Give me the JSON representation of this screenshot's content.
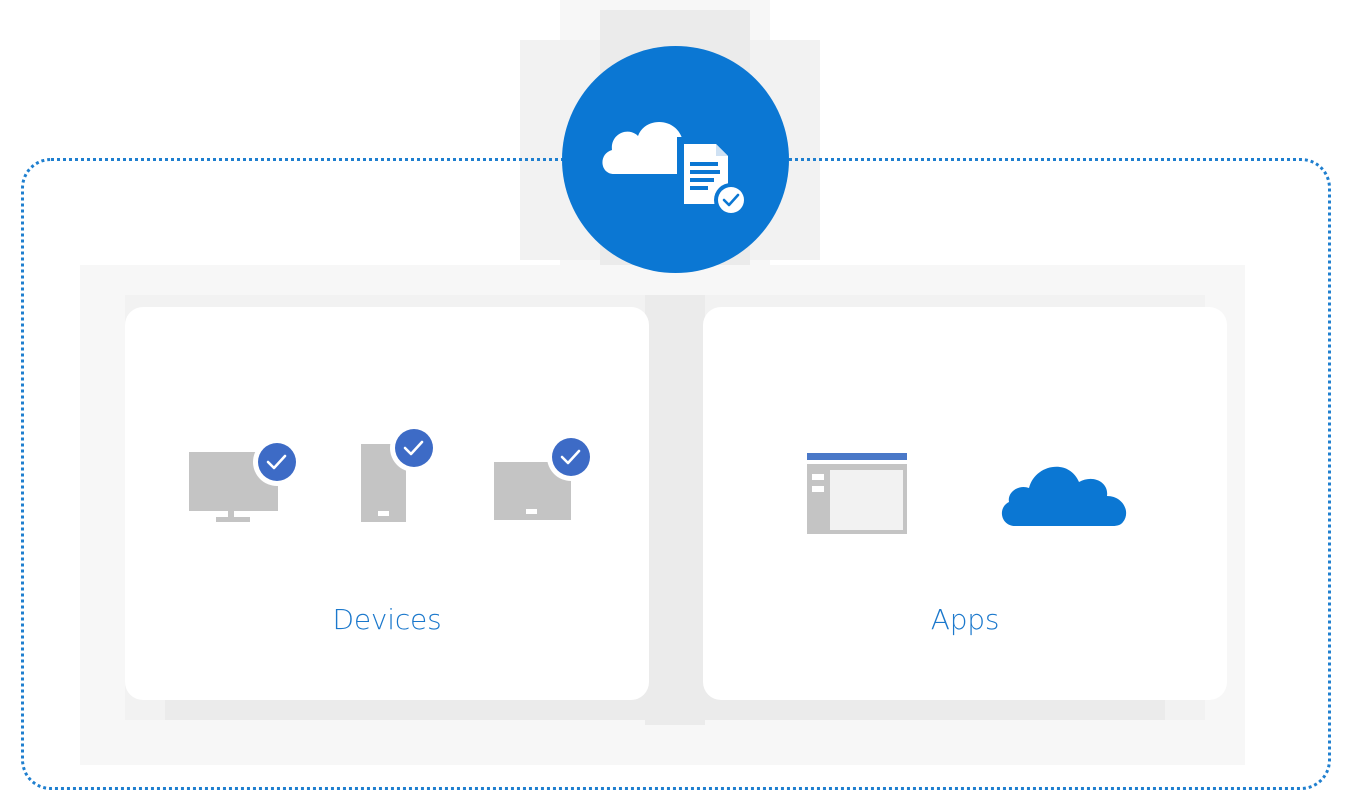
{
  "hub": {
    "icon": "cloud-document-check-icon",
    "color": "#0b77d3"
  },
  "cards": [
    {
      "label": "Devices",
      "icons": [
        "monitor-check-icon",
        "phone-check-icon",
        "tablet-check-icon"
      ]
    },
    {
      "label": "Apps",
      "icons": [
        "app-window-icon",
        "cloud-icon"
      ]
    }
  ],
  "colors": {
    "accent": "#1b78cc",
    "device_gray": "#c4c4c4",
    "check_blue": "#3d6bc6",
    "cloud_blue": "#0b77d3"
  }
}
